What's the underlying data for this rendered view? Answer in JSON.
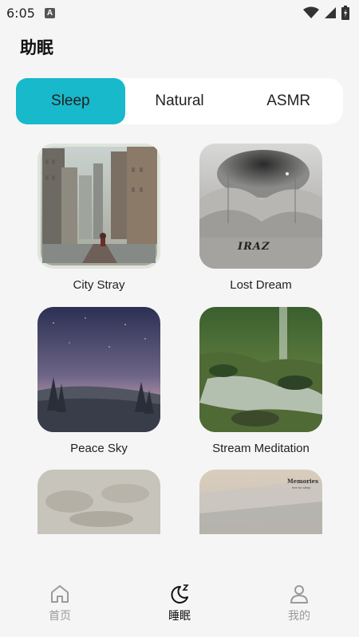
{
  "status_bar": {
    "time": "6:05",
    "notification_badge": "A"
  },
  "page_title": "助眠",
  "tabs": [
    {
      "label": "Sleep",
      "active": true
    },
    {
      "label": "Natural",
      "active": false
    },
    {
      "label": "ASMR",
      "active": false
    }
  ],
  "cards": [
    {
      "title": "City Stray",
      "art": "city-street-art"
    },
    {
      "title": "Lost Dream",
      "art": "cloud-landscape-art",
      "art_text": "IRAZ"
    },
    {
      "title": "Peace Sky",
      "art": "night-forest-art"
    },
    {
      "title": "Stream Meditation",
      "art": "forest-stream-art"
    },
    {
      "title": "",
      "art": "misty-leaves-art"
    },
    {
      "title": "",
      "art": "memories-art",
      "art_text": "Memories",
      "art_subtext": "free for sleep"
    }
  ],
  "bottom_nav": [
    {
      "label": "首页",
      "icon": "home-icon",
      "active": false
    },
    {
      "label": "睡眠",
      "icon": "moon-icon",
      "active": true
    },
    {
      "label": "我的",
      "icon": "profile-icon",
      "active": false
    }
  ],
  "colors": {
    "accent": "#17b9cb",
    "background": "#f5f5f5"
  }
}
